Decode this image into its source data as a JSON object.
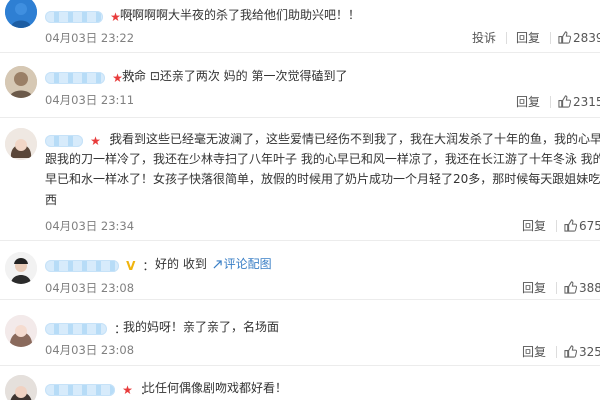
{
  "comments": [
    {
      "badge": "★",
      "badge_color": "red",
      "text": "啊啊啊啊大半夜的杀了我给他们助助兴吧！！",
      "text_link": null,
      "time": "04月03日 23:22",
      "report_label": "投诉",
      "reply_label": "回复",
      "like_count": "2839"
    },
    {
      "badge": "★",
      "badge_color": "red",
      "text": "救命 ⊡还亲了两次 妈的 第一次觉得磕到了",
      "text_link": null,
      "time": "04月03日 23:11",
      "report_label": "",
      "reply_label": "回复",
      "like_count": "2315"
    },
    {
      "badge": "★",
      "badge_color": "red",
      "lines": [
        "我看到这些已经毫无波澜了，这些爱情已经伤不到我了，我在大润发杀了十年的鱼，我的心早",
        "跟我的刀一样冷了，我还在少林寺扫了八年叶子 我的心早已和风一样凉了，我还在长江游了十年冬泳 我的",
        "早已和水一样冰了！女孩子快落很简单，放假的时候用了奶片成功一个月轻了20多，那时候每天跟姐妹吃",
        "西"
      ],
      "time": "04月03日 23:34",
      "report_label": "",
      "reply_label": "回复",
      "like_count": "675"
    },
    {
      "badge": "V",
      "badge_color": "gold",
      "text": "好的 收到",
      "text_link": "评论配图",
      "time": "04月03日 23:08",
      "report_label": "",
      "reply_label": "回复",
      "like_count": "388"
    },
    {
      "badge": "",
      "badge_color": "none",
      "text": "我的妈呀！亲了亲了，名场面",
      "text_link": null,
      "time": "04月03日 23:08",
      "report_label": "",
      "reply_label": "回复",
      "like_count": "325"
    },
    {
      "badge": "★",
      "badge_color": "red",
      "text": "比任何偶像剧吻戏都好看！",
      "text_link": null,
      "time": "",
      "report_label": "",
      "reply_label": "",
      "like_count": ""
    }
  ],
  "colors": {
    "link": "#3a7fc6",
    "badge_red": "#e83b3b",
    "badge_gold": "#f0b40e",
    "time_gray": "#808080"
  }
}
